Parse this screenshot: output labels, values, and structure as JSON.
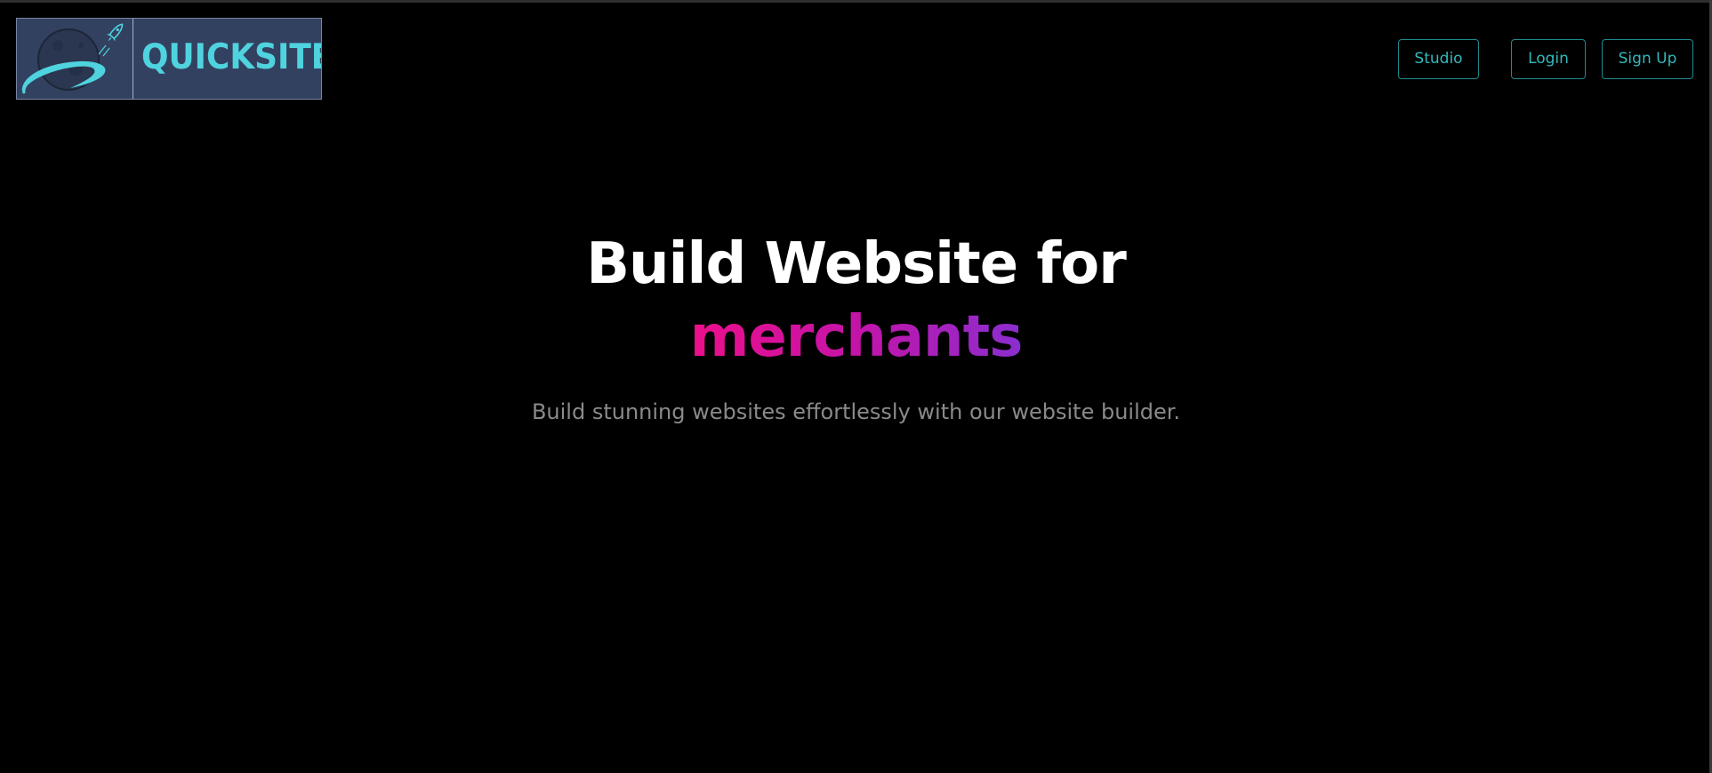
{
  "header": {
    "logo": {
      "text": "QUICKSITE",
      "icon": "planet-rocket-icon"
    },
    "nav": {
      "studio_label": "Studio",
      "login_label": "Login",
      "signup_label": "Sign Up"
    }
  },
  "hero": {
    "title_line1": "Build Website for",
    "title_highlight": "merchants",
    "subtitle": "Build stunning websites effortlessly with our website builder."
  },
  "colors": {
    "background": "#000000",
    "accent_teal": "#34b8bd",
    "logo_bg": "#334160",
    "gradient_start": "#ec0f8a",
    "gradient_end": "#8a2ed0",
    "subtitle": "#8a8a8a"
  }
}
